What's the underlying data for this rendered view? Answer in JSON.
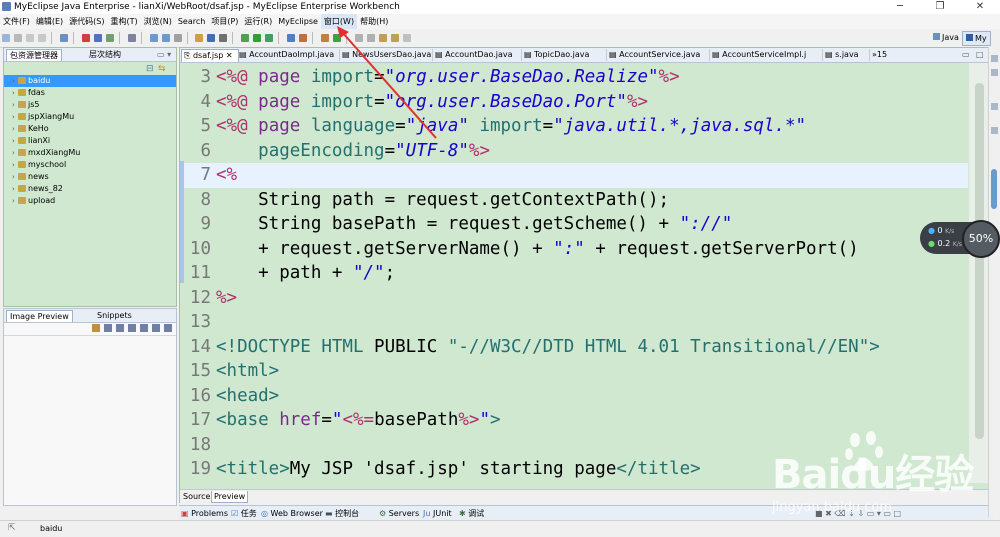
{
  "window": {
    "title": "MyEclipse Java Enterprise - lianXi/WebRoot/dsaf.jsp - MyEclipse Enterprise Workbench",
    "minimize": "─",
    "maximize": "❐",
    "close": "✕"
  },
  "menu": [
    "文件(F)",
    "编辑(E)",
    "源代码(S)",
    "重构(T)",
    "浏览(N)",
    "Search",
    "项目(P)",
    "运行(R)",
    "MyEclipse",
    "窗口(W)",
    "帮助(H)"
  ],
  "perspectives": [
    "Java",
    "My"
  ],
  "package_explorer": {
    "tabs": [
      "包资源管理器",
      "层次结构"
    ],
    "projects": [
      "baidu",
      "fdas",
      "js5",
      "jspXiangMu",
      "KeHo",
      "lianXi",
      "mxdXiangMu",
      "myschool",
      "news",
      "news_82",
      "upload"
    ],
    "selected": "baidu"
  },
  "lower_left": {
    "tabs": [
      "Image Preview",
      "Snippets"
    ]
  },
  "editor": {
    "tabs": [
      "dsaf.jsp",
      "AccountDaoImpl.java",
      "NewsUsersDao.java",
      "AccountDao.java",
      "TopicDao.java",
      "AccountService.java",
      "AccountServiceImpl.j",
      "s.java",
      "»15"
    ],
    "active_tab": "dsaf.jsp",
    "lines": [
      {
        "n": "3",
        "segs": [
          [
            "tag",
            "<%@ "
          ],
          [
            "kw",
            "page "
          ],
          [
            "gtk",
            "import"
          ],
          [
            "txt",
            "="
          ],
          [
            "str",
            "\"org.user.BaseDao.Realize\""
          ],
          [
            "tag",
            "%>"
          ]
        ]
      },
      {
        "n": "4",
        "segs": [
          [
            "tag",
            "<%@ "
          ],
          [
            "kw",
            "page "
          ],
          [
            "gtk",
            "import"
          ],
          [
            "txt",
            "="
          ],
          [
            "str",
            "\"org.user.BaseDao.Port\""
          ],
          [
            "tag",
            "%>"
          ]
        ]
      },
      {
        "n": "5",
        "segs": [
          [
            "tag",
            "<%@ "
          ],
          [
            "kw",
            "page "
          ],
          [
            "gtk",
            "language"
          ],
          [
            "txt",
            "="
          ],
          [
            "str",
            "\"java\""
          ],
          [
            "txt",
            " "
          ],
          [
            "gtk",
            "import"
          ],
          [
            "txt",
            "="
          ],
          [
            "str",
            "\"java.util.*,java.sql.*\""
          ]
        ]
      },
      {
        "n": "6",
        "segs": [
          [
            "txt",
            "    "
          ],
          [
            "gtk",
            "pageEncoding"
          ],
          [
            "txt",
            "="
          ],
          [
            "str",
            "\"UTF-8\""
          ],
          [
            "tag",
            "%>"
          ]
        ]
      },
      {
        "n": "7",
        "segs": [
          [
            "tag",
            "<%"
          ]
        ]
      },
      {
        "n": "8",
        "segs": [
          [
            "txt",
            "    String path = request.getContextPath();"
          ]
        ]
      },
      {
        "n": "9",
        "segs": [
          [
            "txt",
            "    String basePath = request.getScheme() + "
          ],
          [
            "str",
            "\"://\""
          ]
        ]
      },
      {
        "n": "10",
        "segs": [
          [
            "txt",
            "    + request.getServerName() + "
          ],
          [
            "str",
            "\":\""
          ],
          [
            "txt",
            " + request.getServerPort()"
          ]
        ]
      },
      {
        "n": "11",
        "segs": [
          [
            "txt",
            "    + path + "
          ],
          [
            "str",
            "\"/\""
          ],
          [
            "txt",
            ";"
          ]
        ]
      },
      {
        "n": "12",
        "segs": [
          [
            "tag",
            "%>"
          ]
        ]
      },
      {
        "n": "13",
        "segs": []
      },
      {
        "n": "14",
        "segs": [
          [
            "gtk",
            "<!DOCTYPE HTML "
          ],
          [
            "txt",
            "PUBLIC "
          ],
          [
            "gtk",
            "\"-//W3C//DTD HTML 4.01 Transitional//EN\""
          ],
          [
            "gtk",
            ">"
          ]
        ]
      },
      {
        "n": "15",
        "segs": [
          [
            "gtk",
            "<html>"
          ]
        ]
      },
      {
        "n": "16",
        "segs": [
          [
            "gtk",
            "<head>"
          ]
        ]
      },
      {
        "n": "17",
        "segs": [
          [
            "gtk",
            "<base "
          ],
          [
            "kw",
            "href"
          ],
          [
            "txt",
            "="
          ],
          [
            "str",
            "\""
          ],
          [
            "tag",
            "<%="
          ],
          [
            "txt",
            "basePath"
          ],
          [
            "tag",
            "%>"
          ],
          [
            "str",
            "\""
          ],
          [
            "gtk",
            ">"
          ]
        ]
      },
      {
        "n": "18",
        "segs": []
      },
      {
        "n": "19",
        "segs": [
          [
            "gtk",
            "<title>"
          ],
          [
            "txt",
            "My JSP 'dsaf.jsp' starting page"
          ],
          [
            "gtk",
            "</title>"
          ]
        ]
      }
    ],
    "current_line_index": 4,
    "source_tabs": [
      "Source",
      "Preview"
    ]
  },
  "bottom_tabs": [
    "Problems",
    "任务",
    "Web Browser",
    "控制台",
    "Servers",
    "JUnit",
    "调试"
  ],
  "status_bar": {
    "text": "baidu"
  },
  "network_widget": {
    "up": "0",
    "down": "0.2",
    "unit": "K/s",
    "percent": "50%"
  },
  "watermark": {
    "brand": "Baidu经验",
    "url": "jingyan.baidu.com"
  },
  "colors": {
    "editor_bg": "#cfe8cf",
    "current_line": "#e8f2fe",
    "selection": "#3399ff",
    "annotation_arrow": "#e03030"
  }
}
